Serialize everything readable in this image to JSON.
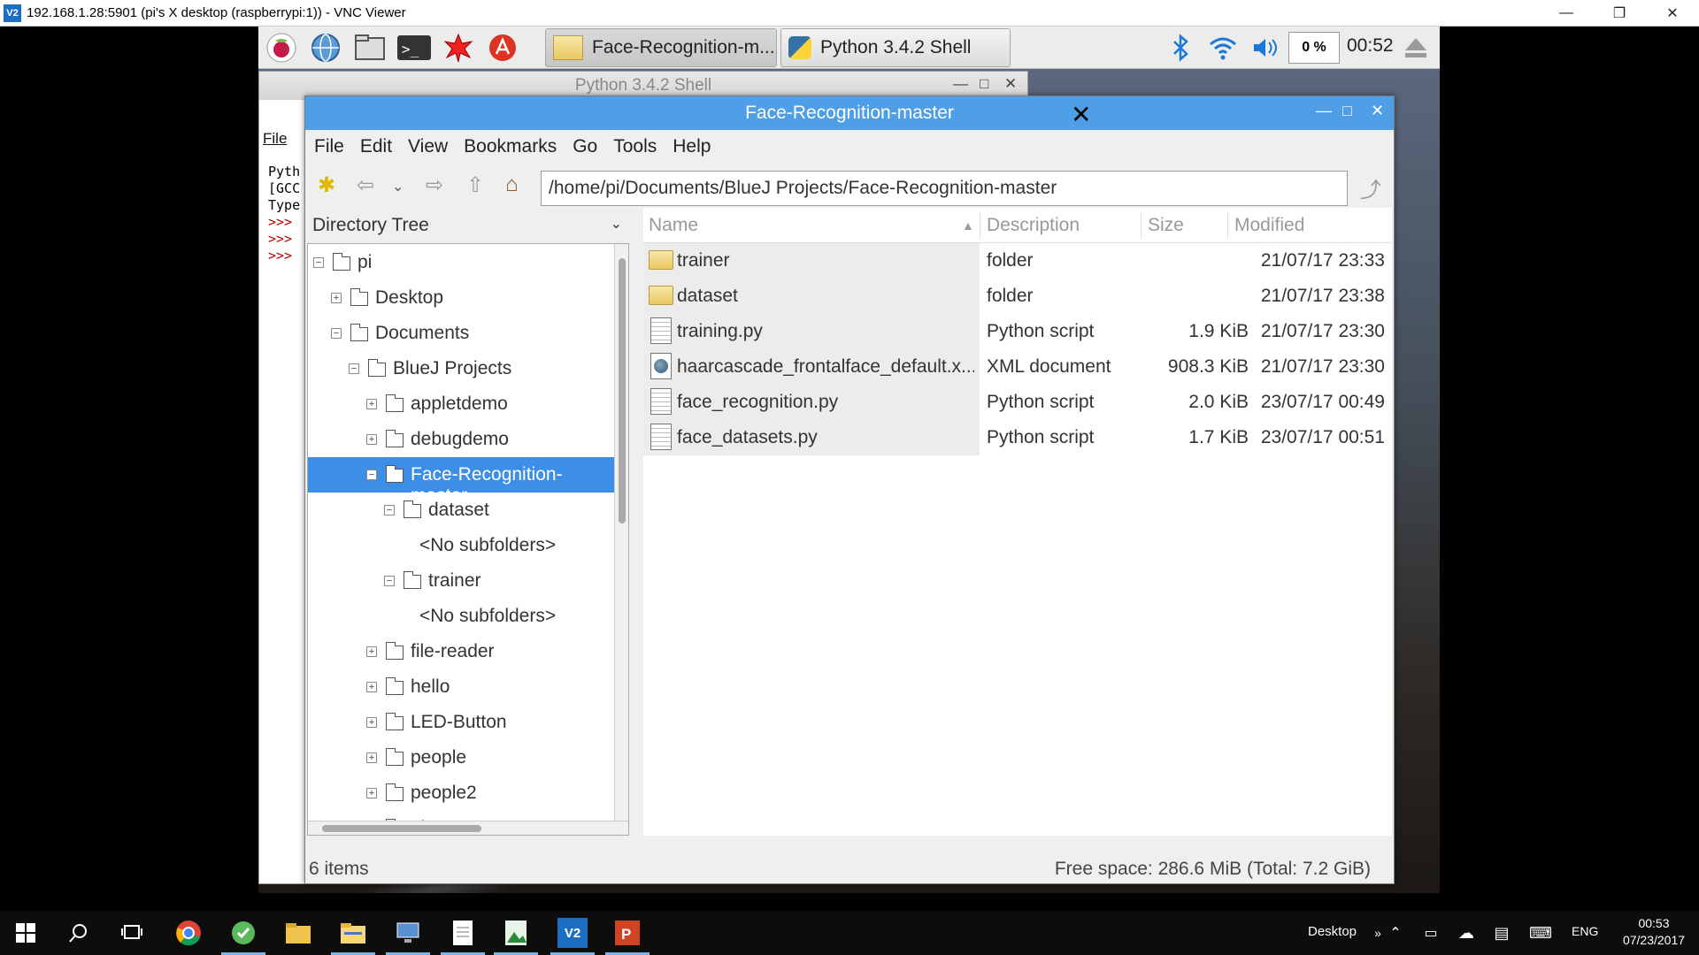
{
  "vnc": {
    "title": "192.168.1.28:5901 (pi's X desktop (raspberrypi:1)) - VNC Viewer",
    "logo": "V2"
  },
  "lx_panel": {
    "launchers": [
      "raspberry-menu-icon",
      "web-browser-icon",
      "file-manager-icon",
      "terminal-icon",
      "math-kernel-icon",
      "wolfram-icon"
    ],
    "tasks": [
      {
        "label": "Face-Recognition-m...",
        "icon": "folder-icon"
      },
      {
        "label": "Python 3.4.2 Shell",
        "icon": "python-icon"
      }
    ],
    "cpu": "0 %",
    "clock": "00:52"
  },
  "python_shell": {
    "title": "Python 3.4.2 Shell",
    "menu_file": "File",
    "lines": [
      "Pyth",
      "[GCC",
      "Type"
    ],
    "prompts": [
      ">>>",
      ">>>",
      ">>>"
    ]
  },
  "file_manager": {
    "title": "Face-Recognition-master",
    "menu": [
      "File",
      "Edit",
      "View",
      "Bookmarks",
      "Go",
      "Tools",
      "Help"
    ],
    "path": "/home/pi/Documents/BlueJ Projects/Face-Recognition-master",
    "tree_header": "Directory Tree",
    "tree": [
      {
        "label": "pi",
        "expander": "−",
        "icon": "home-folder-icon"
      },
      {
        "label": "Desktop",
        "expander": "+",
        "icon": "desktop-folder-icon"
      },
      {
        "label": "Documents",
        "expander": "−",
        "icon": "documents-folder-icon"
      },
      {
        "label": "BlueJ Projects",
        "expander": "−",
        "icon": "folder-icon"
      },
      {
        "label": "appletdemo",
        "expander": "+",
        "icon": "folder-icon"
      },
      {
        "label": "debugdemo",
        "expander": "+",
        "icon": "folder-icon"
      },
      {
        "label": "Face-Recognition-master",
        "expander": "−",
        "icon": "folder-icon",
        "selected": true
      },
      {
        "label": "dataset",
        "expander": "−",
        "icon": "folder-icon"
      },
      {
        "label": "<No subfolders>",
        "expander": "",
        "icon": ""
      },
      {
        "label": "trainer",
        "expander": "−",
        "icon": "folder-icon"
      },
      {
        "label": "<No subfolders>",
        "expander": "",
        "icon": ""
      },
      {
        "label": "file-reader",
        "expander": "+",
        "icon": "folder-icon"
      },
      {
        "label": "hello",
        "expander": "+",
        "icon": "folder-icon"
      },
      {
        "label": "LED-Button",
        "expander": "+",
        "icon": "folder-icon"
      },
      {
        "label": "people",
        "expander": "+",
        "icon": "folder-icon"
      },
      {
        "label": "people2",
        "expander": "+",
        "icon": "folder-icon"
      },
      {
        "label": "picture",
        "expander": "+",
        "icon": "folder-icon"
      }
    ],
    "columns": {
      "name": "Name",
      "description": "Description",
      "size": "Size",
      "modified": "Modified"
    },
    "files": [
      {
        "name": "trainer",
        "description": "folder",
        "size": "",
        "modified": "21/07/17 23:33",
        "icon": "folder-icon"
      },
      {
        "name": "dataset",
        "description": "folder",
        "size": "",
        "modified": "21/07/17 23:38",
        "icon": "folder-icon"
      },
      {
        "name": "training.py",
        "description": "Python script",
        "size": "1.9 KiB",
        "modified": "21/07/17 23:30",
        "icon": "script-icon"
      },
      {
        "name": "haarcascade_frontalface_default.x...",
        "description": "XML document",
        "size": "908.3 KiB",
        "modified": "21/07/17 23:30",
        "icon": "xml-icon"
      },
      {
        "name": "face_recognition.py",
        "description": "Python script",
        "size": "2.0 KiB",
        "modified": "23/07/17 00:49",
        "icon": "script-icon"
      },
      {
        "name": "face_datasets.py",
        "description": "Python script",
        "size": "1.7 KiB",
        "modified": "23/07/17 00:51",
        "icon": "script-icon"
      }
    ],
    "status_items": "6 items",
    "status_free": "Free space: 286.6 MiB (Total: 7.2 GiB)"
  },
  "windows_taskbar": {
    "apps": [
      "start-icon",
      "search-icon",
      "task-view-icon",
      "chrome-icon",
      "app-green-icon",
      "explorer-folder-icon",
      "file-explorer-icon",
      "network-app-icon",
      "notepad-icon",
      "image-app-icon",
      "vnc-viewer-icon",
      "powerpoint-icon"
    ],
    "desktop_label": "Desktop",
    "lang": "ENG",
    "time": "00:53",
    "date": "07/23/2017"
  },
  "colors": {
    "fm_title_bar": "#4f9fe8",
    "selection": "#3d8ee6"
  }
}
